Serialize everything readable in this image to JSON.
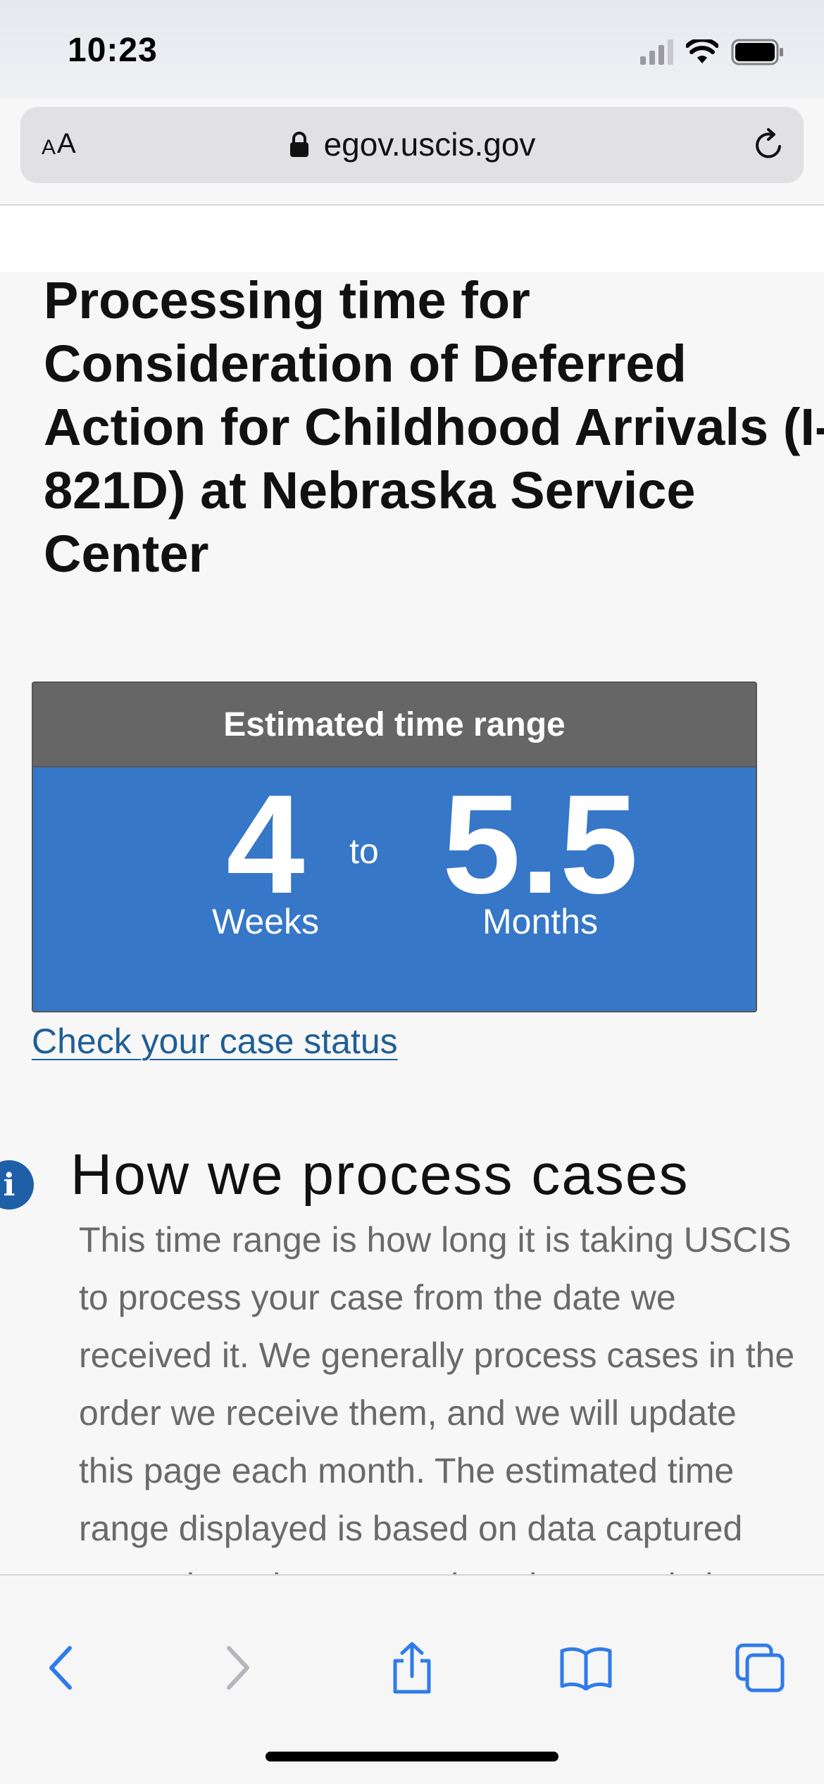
{
  "status_bar": {
    "time": "10:23"
  },
  "browser": {
    "text_size_small": "A",
    "text_size_large": "A",
    "url": "egov.uscis.gov",
    "icons": {
      "lock": "lock-icon",
      "reload": "reload-icon",
      "back": "chevron-left-icon",
      "forward": "chevron-right-icon",
      "share": "share-icon",
      "bookmarks": "book-icon",
      "tabs": "tabs-icon"
    }
  },
  "page": {
    "title": "Processing time for\nConsideration of Deferred\nAction for Childhood Arrivals (I-\n821D) at Nebraska Service\nCenter",
    "estimate_card": {
      "header": "Estimated time range",
      "min_value": "4",
      "min_unit": "Weeks",
      "separator": "to",
      "max_value": "5.5",
      "max_unit": "Months"
    },
    "case_status_link": "Check your case status",
    "info_icon_glyph": "i",
    "section_heading": "How we process cases",
    "section_body": "This time range is how long it is taking USCIS\nto process your case from the date we\nreceived it. We generally process cases in the\norder we receive them, and we will update\nthis page each month. The estimated time\nrange displayed is based on data captured\napproximately two months prior to updating"
  },
  "colors": {
    "card_header_bg": "#666666",
    "card_body_bg": "#3677c8",
    "link": "#1f5f95",
    "toolbar_accent": "#2f7bea",
    "toolbar_disabled": "#b5b5ba"
  }
}
